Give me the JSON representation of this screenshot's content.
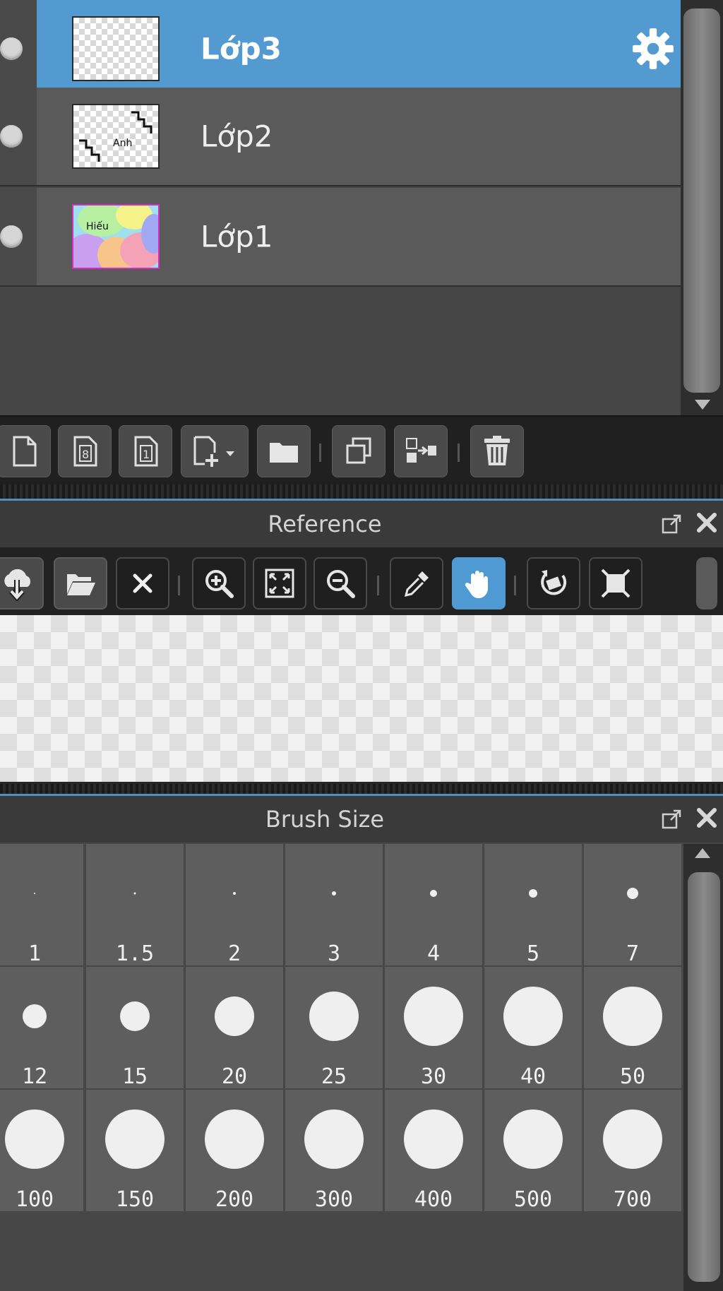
{
  "layers": {
    "items": [
      {
        "name": "Lớp3",
        "selected": true,
        "has_settings_icon": true,
        "thumbnail": "transparent"
      },
      {
        "name": "Lớp2",
        "selected": false,
        "thumbnail": "sketch",
        "thumbnail_text": "Anh"
      },
      {
        "name": "Lớp1",
        "selected": false,
        "thumbnail": "colors",
        "thumbnail_text": "Hiếu"
      }
    ],
    "toolbar_icons": [
      "new-layer-icon",
      "new-8bit-layer-icon",
      "new-1bit-layer-icon",
      "add-layer-menu-icon",
      "new-folder-icon",
      "duplicate-layer-icon",
      "merge-down-icon",
      "delete-layer-icon"
    ]
  },
  "reference": {
    "title": "Reference",
    "toolbar_icons": [
      "cloud-download-icon",
      "open-folder-icon",
      "close-icon",
      "zoom-in-icon",
      "fit-screen-icon",
      "zoom-out-icon",
      "eyedropper-icon",
      "hand-icon",
      "rotate-icon",
      "fit-window-icon"
    ],
    "active_tool": "hand-icon"
  },
  "brush_size": {
    "title": "Brush Size",
    "sizes": [
      [
        "1",
        "1.5",
        "2",
        "3",
        "4",
        "5",
        "7"
      ],
      [
        "12",
        "15",
        "20",
        "25",
        "30",
        "40",
        "50"
      ],
      [
        "100",
        "150",
        "200",
        "300",
        "400",
        "500",
        "700"
      ]
    ]
  },
  "colors": {
    "accent": "#529ad0",
    "panel_bg": "#474747",
    "row_bg": "#5a5a5a"
  }
}
